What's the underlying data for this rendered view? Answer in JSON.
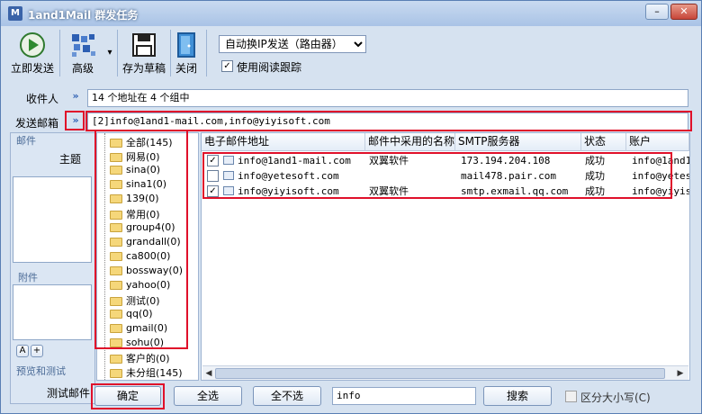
{
  "window": {
    "title": "1and1Mail 群发任务",
    "icon_text": "M",
    "minimize_glyph": "–",
    "maximize_glyph": "▢",
    "close_glyph": "✕"
  },
  "toolbar": {
    "send_now": "立即发送",
    "advanced": "高级",
    "save_draft": "存为草稿",
    "close": "关闭",
    "dropdown_glyph": "▾",
    "send_mode_value": "自动换IP发送（路由器）",
    "read_tracking_label": "使用阅读跟踪",
    "read_tracking_checked": true
  },
  "form": {
    "recipients_label": "收件人",
    "recipients_value": "14 个地址在 4 个组中",
    "sender_label": "发送邮箱",
    "sender_value": "[2]info@1and1-mail.com,info@yiyisoft.com",
    "expand_glyph": "»"
  },
  "left_panel": {
    "mail_header": "邮件",
    "subject_label": "主题",
    "attachment_header": "附件",
    "font_btn": "A",
    "plus_btn": "+",
    "preview_header": "预览和测试",
    "test_mail_label": "测试邮件"
  },
  "tree": {
    "items": [
      "全部(145)",
      "网易(0)",
      "sina(0)",
      "sina1(0)",
      "139(0)",
      "常用(0)",
      "group4(0)",
      "grandall(0)",
      "ca800(0)",
      "bossway(0)",
      "yahoo(0)",
      "测试(0)",
      "qq(0)",
      "gmail(0)",
      "sohu(0)",
      "客户的(0)",
      "未分组(145)"
    ]
  },
  "grid": {
    "headers": [
      "电子邮件地址",
      "邮件中采用的名称",
      "SMTP服务器",
      "状态",
      "账户"
    ],
    "rows": [
      {
        "checked": true,
        "email": "info@1and1-mail.com",
        "name": "双翼软件",
        "smtp": "173.194.204.108",
        "status": "成功",
        "account": "info@1and1"
      },
      {
        "checked": false,
        "email": "info@yetesoft.com",
        "name": "",
        "smtp": "mail478.pair.com",
        "status": "成功",
        "account": "info@yetes"
      },
      {
        "checked": true,
        "email": "info@yiyisoft.com",
        "name": "双翼软件",
        "smtp": "smtp.exmail.qq.com",
        "status": "成功",
        "account": "info@yiyis"
      }
    ],
    "scroll_left": "◀",
    "scroll_right": "▶"
  },
  "bottom": {
    "ok": "确定",
    "select_all": "全选",
    "select_none": "全不选",
    "search_value": "info",
    "search_btn": "搜索",
    "case_label": "区分大小写(C)",
    "case_checked": false
  },
  "colors": {
    "highlight": "#e0102a",
    "accent": "#2d5fb3"
  }
}
